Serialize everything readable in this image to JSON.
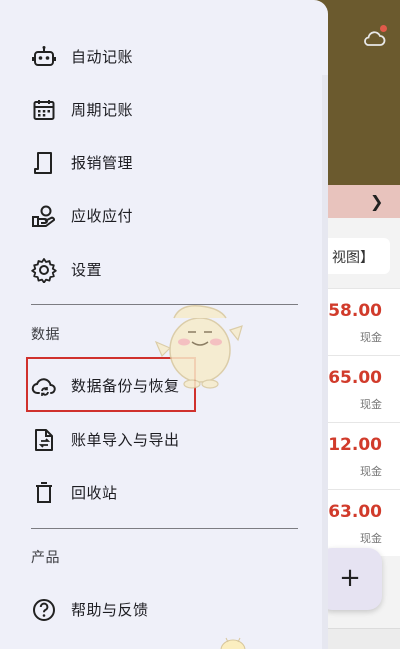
{
  "drawer": {
    "items_top": [
      {
        "label": "自动记账",
        "icon": "robot-icon"
      },
      {
        "label": "周期记账",
        "icon": "calendar-icon"
      },
      {
        "label": "报销管理",
        "icon": "receipt-icon"
      },
      {
        "label": "应收应付",
        "icon": "hand-coin-icon"
      },
      {
        "label": "设置",
        "icon": "gear-icon"
      }
    ],
    "section_data": "数据",
    "items_data": [
      {
        "label": "数据备份与恢复",
        "icon": "cloud-sync-icon"
      },
      {
        "label": "账单导入与导出",
        "icon": "file-transfer-icon"
      },
      {
        "label": "回收站",
        "icon": "trash-icon"
      }
    ],
    "section_product": "产品",
    "items_product": [
      {
        "label": "帮助与反馈",
        "icon": "help-icon"
      }
    ]
  },
  "background": {
    "view_label": "视图】",
    "rows": [
      {
        "amount": "-58.00",
        "method": "现金"
      },
      {
        "amount": "-65.00",
        "method": "现金"
      },
      {
        "amount": "-12.00",
        "method": "现金"
      },
      {
        "amount": "-63.00",
        "method": "现金"
      }
    ],
    "fab_label": "+"
  },
  "colors": {
    "drawer_bg": "#eff0f9",
    "header_bg": "#6b5a2e",
    "expense_red": "#d13b2b",
    "highlight_border": "#d0312d"
  }
}
